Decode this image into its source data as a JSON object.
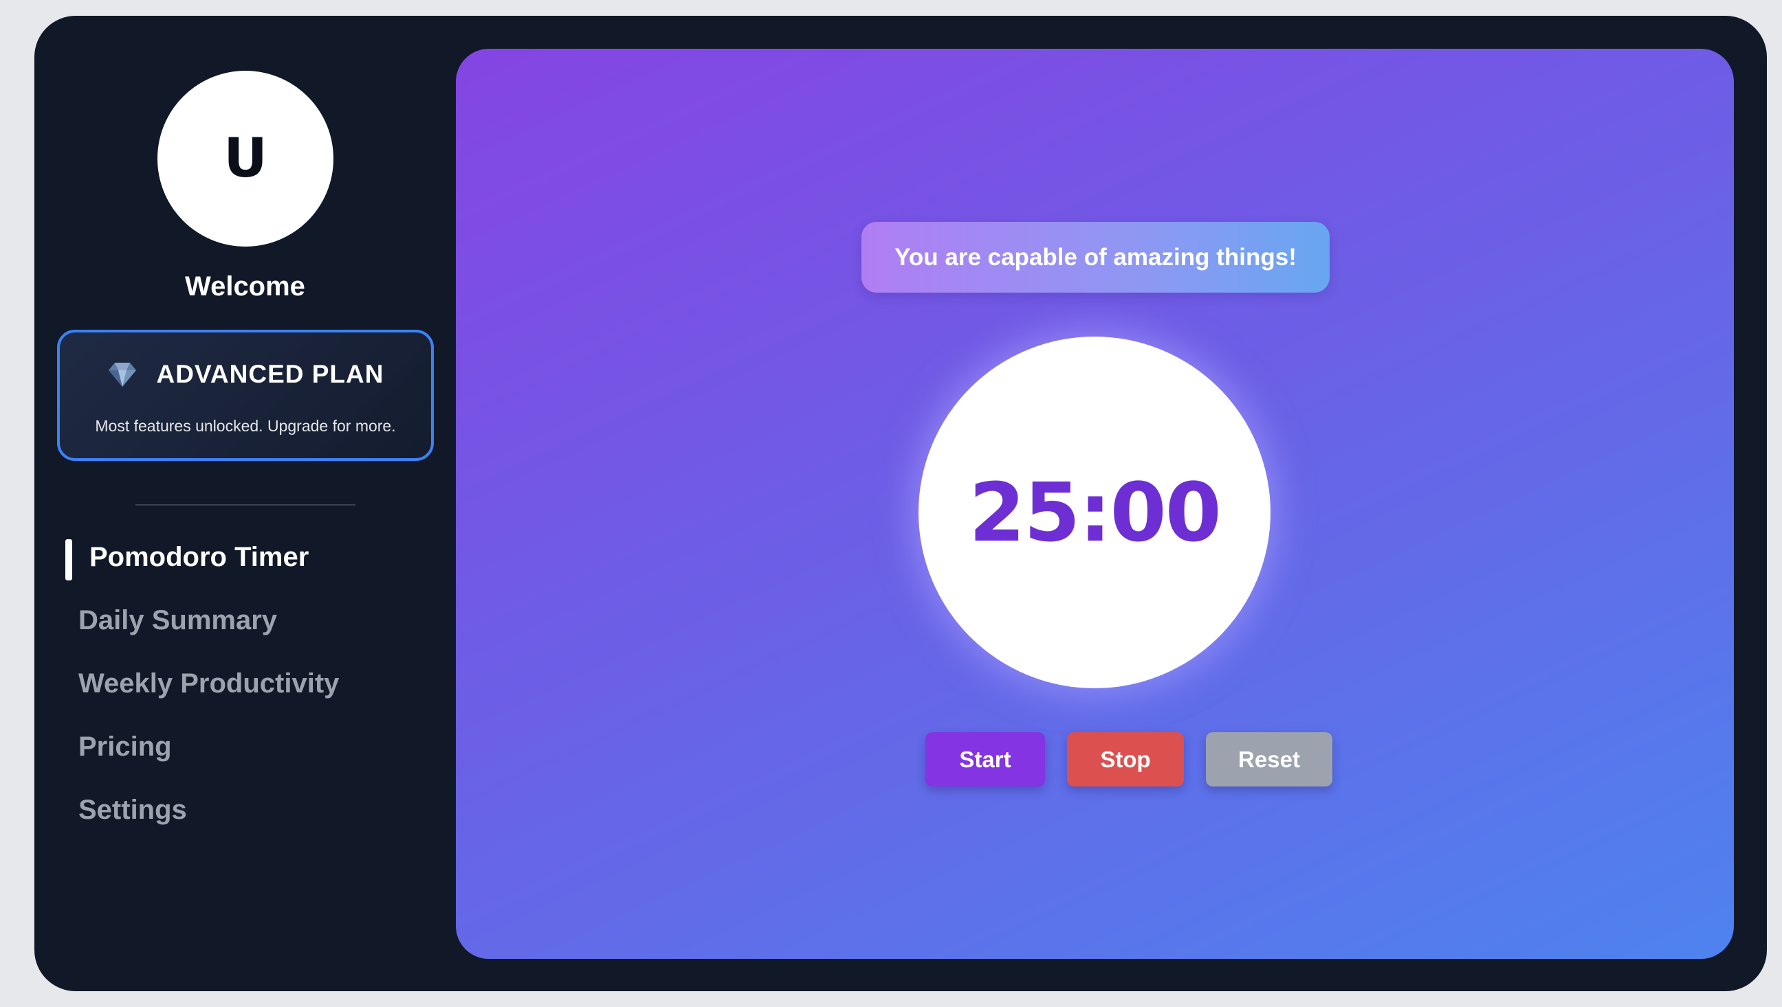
{
  "profile": {
    "avatar_initial": "U",
    "welcome_text": "Welcome"
  },
  "plan": {
    "icon": "gem-icon",
    "title": "ADVANCED PLAN",
    "description": "Most features unlocked. Upgrade for more."
  },
  "nav": {
    "items": [
      {
        "label": "Pomodoro Timer",
        "active": true
      },
      {
        "label": "Daily Summary",
        "active": false
      },
      {
        "label": "Weekly Productivity",
        "active": false
      },
      {
        "label": "Pricing",
        "active": false
      },
      {
        "label": "Settings",
        "active": false
      }
    ]
  },
  "main": {
    "quote": "You are capable of amazing things!",
    "timer": "25:00",
    "buttons": {
      "start": "Start",
      "stop": "Stop",
      "reset": "Reset"
    }
  },
  "colors": {
    "sidebar_bg": "#111827",
    "accent_purple": "#8434e2",
    "stop_red": "#dc5050",
    "reset_gray": "#9ca3af",
    "plan_border": "#3b82f6",
    "timer_text": "#6d2fd3"
  }
}
